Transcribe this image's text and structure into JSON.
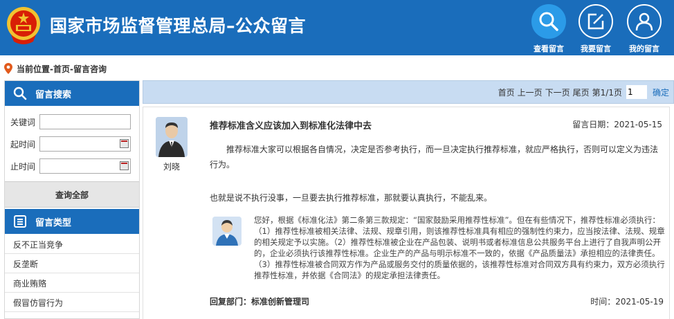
{
  "header": {
    "title": "国家市场监督管理总局–公众留言",
    "nav": [
      {
        "label": "查看留言",
        "icon": "search-icon"
      },
      {
        "label": "我要留言",
        "icon": "compose-icon"
      },
      {
        "label": "我的留言",
        "icon": "user-icon"
      }
    ]
  },
  "breadcrumb": "当前位置-首页-留言咨询",
  "sidebar": {
    "search_title": "留言搜索",
    "keyword_label": "关键词",
    "start_label": "起时间",
    "end_label": "止时间",
    "query_all": "查询全部",
    "type_title": "留言类型",
    "types": [
      "反不正当竞争",
      "反垄断",
      "商业贿赂",
      "假冒仿冒行为"
    ]
  },
  "pager": {
    "first": "首页",
    "prev": "上一页",
    "next": "下一页",
    "last": "尾页",
    "info": "第1/1页",
    "page_value": "1",
    "confirm": "确定"
  },
  "message": {
    "author": "刘晓",
    "title": "推荐标准含义应该加入到标准化法律中去",
    "date": "留言日期：2021-05-15",
    "body_1": "推荐标准大家可以根据各自情况，决定是否参考执行，而一旦决定执行推荐标准，就应严格执行，否则可以定义为违法行为。",
    "body_2": "也就是说不执行没事，一旦要去执行推荐标准，那就要认真执行，不能乱来。",
    "reply": "您好，根据《标准化法》第二条第三款规定：“国家鼓励采用推荐性标准”。但在有些情况下，推荐性标准必须执行：（1）推荐性标准被相关法律、法规、规章引用，则该推荐性标准具有相应的强制性约束力，应当按法律、法规、规章的相关规定予以实施。（2）推荐性标准被企业在产品包装、说明书或者标准信息公共服务平台上进行了自我声明公开的，企业必须执行该推荐性标准。企业生产的产品与明示标准不一致的，依据《产品质量法》承担相应的法律责任。（3）推荐性标准被合同双方作为产品或服务交付的质量依据的，该推荐性标准对合同双方具有约束力，双方必须执行推荐性标准，并依据《合同法》的规定承担法律责任。",
    "reply_dept": "回复部门：标准创新管理司",
    "reply_time": "时间：2021-05-19"
  }
}
